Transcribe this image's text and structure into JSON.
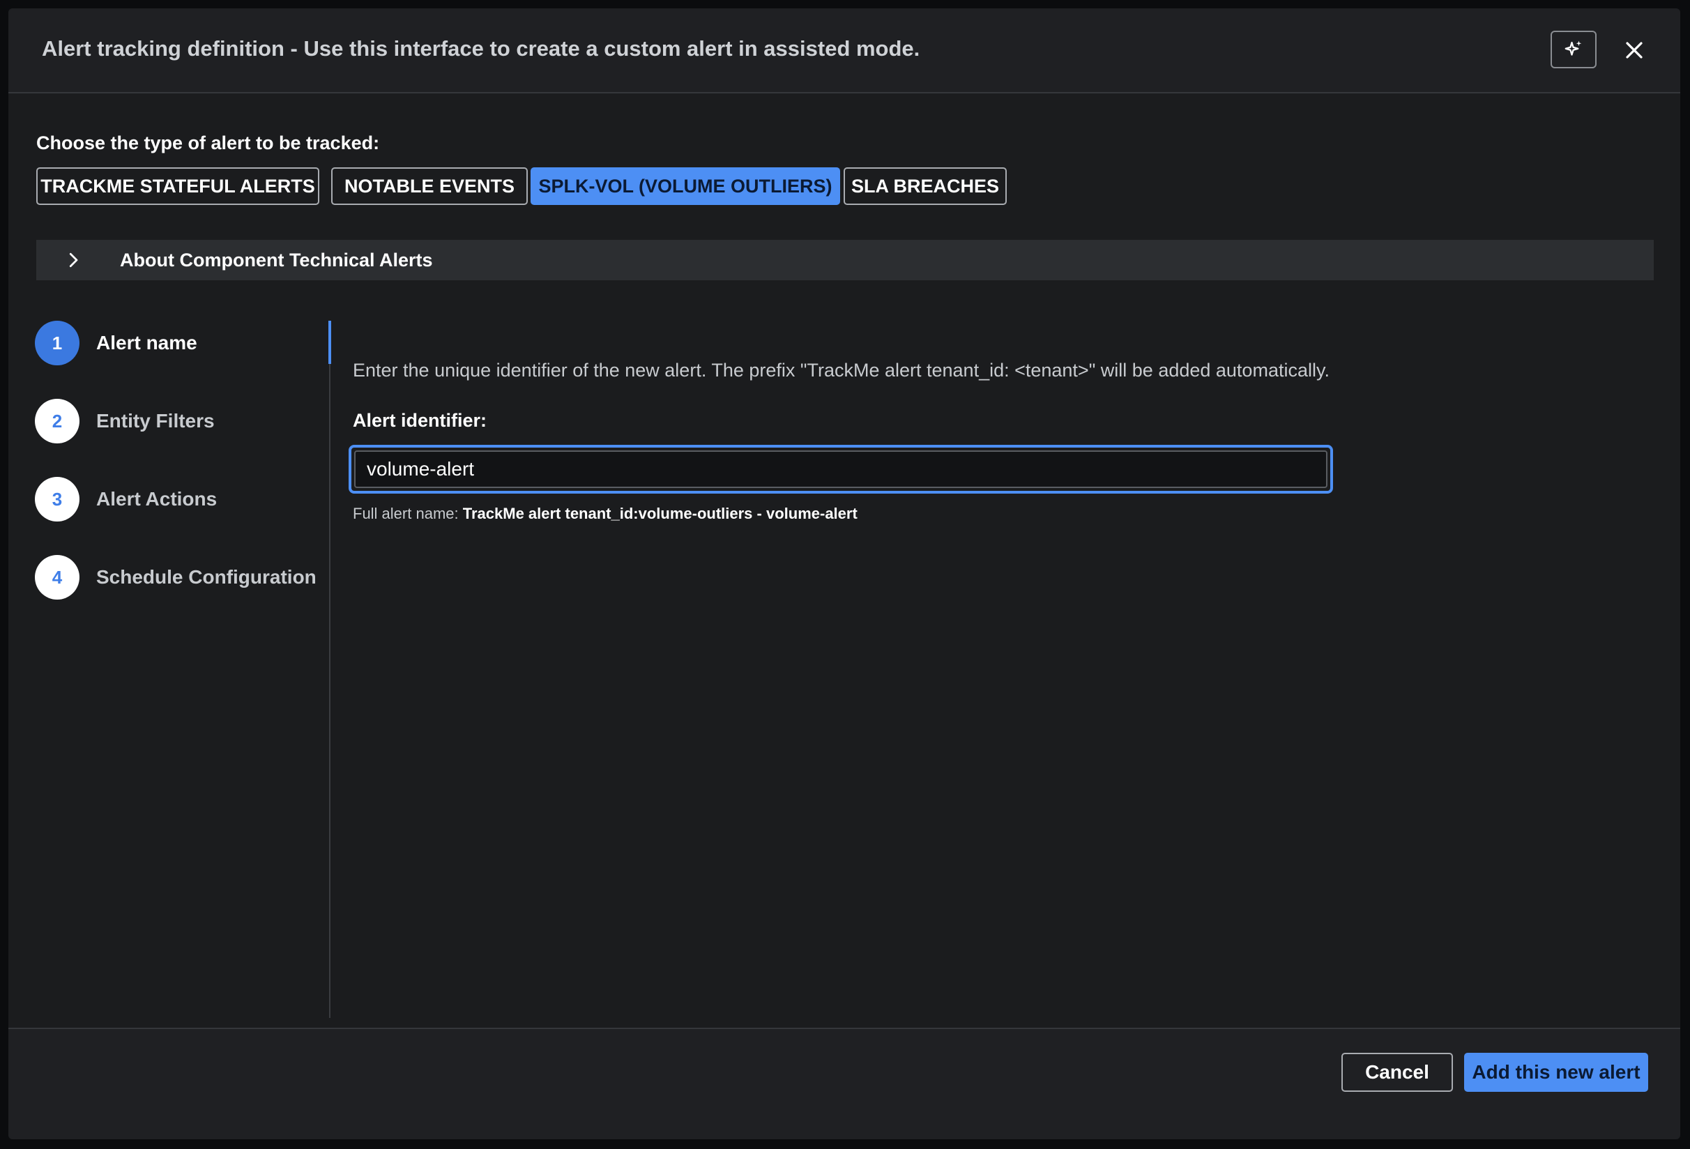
{
  "modal": {
    "title": "Alert tracking definition - Use this interface to create a custom alert in assisted mode."
  },
  "icons": {
    "ai": "sparkle-icon",
    "close": "close-icon",
    "chevron": "chevron-right-icon"
  },
  "alert_type": {
    "label": "Choose the type of alert to be tracked:",
    "options": [
      {
        "label": "TRACKME STATEFUL ALERTS",
        "active": false
      },
      {
        "label": "NOTABLE EVENTS",
        "active": false
      },
      {
        "label": "SPLK-VOL (VOLUME OUTLIERS)",
        "active": true
      },
      {
        "label": "SLA BREACHES",
        "active": false
      }
    ]
  },
  "about": {
    "label": "About Component Technical Alerts"
  },
  "steps": [
    {
      "number": "1",
      "label": "Alert name",
      "active": true
    },
    {
      "number": "2",
      "label": "Entity Filters",
      "active": false
    },
    {
      "number": "3",
      "label": "Alert Actions",
      "active": false
    },
    {
      "number": "4",
      "label": "Schedule Configuration",
      "active": false
    }
  ],
  "form": {
    "intro": "Enter the unique identifier of the new alert. The prefix \"TrackMe alert tenant_id: <tenant>\" will be added automatically.",
    "identifier_label": "Alert identifier:",
    "identifier_value": "volume-alert",
    "fullname_label": "Full alert name:",
    "fullname_value": "TrackMe alert tenant_id:volume-outliers - volume-alert"
  },
  "footer": {
    "cancel_label": "Cancel",
    "add_label": "Add this new alert"
  },
  "colors": {
    "accent": "#4d8ff4",
    "background": "#1b1c1e",
    "step_active": "#3b79e0"
  }
}
